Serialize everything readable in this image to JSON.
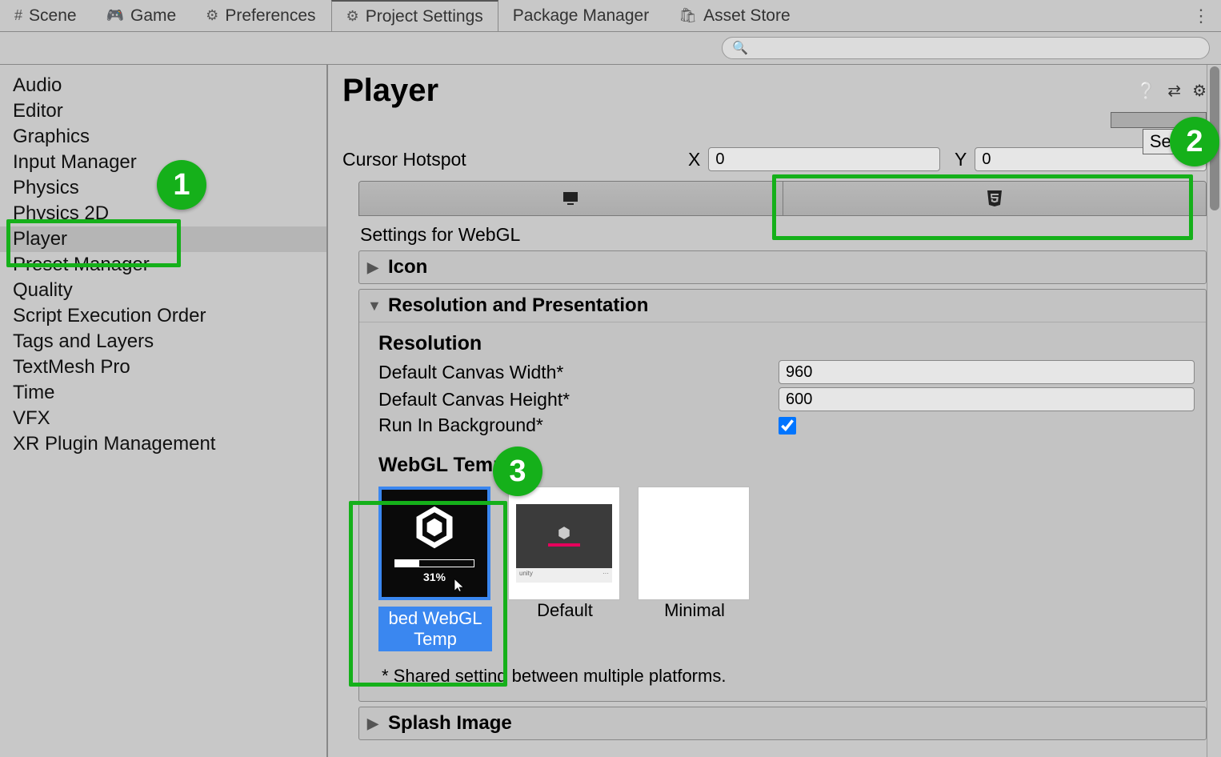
{
  "tabs": {
    "scene": "Scene",
    "game": "Game",
    "preferences": "Preferences",
    "project_settings": "Project Settings",
    "package_manager": "Package Manager",
    "asset_store": "Asset Store"
  },
  "sidebar": {
    "items": [
      "Audio",
      "Editor",
      "Graphics",
      "Input Manager",
      "Physics",
      "Physics 2D",
      "Player",
      "Preset Manager",
      "Quality",
      "Script Execution Order",
      "Tags and Layers",
      "TextMesh Pro",
      "Time",
      "VFX",
      "XR Plugin Management"
    ],
    "selected_index": 6
  },
  "content": {
    "title": "Player",
    "select_button": "Select",
    "cursor_hotspot_label": "Cursor Hotspot",
    "cursor_x": "0",
    "cursor_y": "0",
    "settings_header": "Settings for WebGL",
    "icon_section": "Icon",
    "res_section": "Resolution and Presentation",
    "resolution_heading": "Resolution",
    "canvas_width_label": "Default Canvas Width*",
    "canvas_width": "960",
    "canvas_height_label": "Default Canvas Height*",
    "canvas_height": "600",
    "run_bg_label": "Run In Background*",
    "run_bg_checked": true,
    "template_heading": "WebGL Template",
    "templates": [
      {
        "label": "bed WebGL Temp",
        "selected": true,
        "progress": "31%"
      },
      {
        "label": "Default",
        "selected": false
      },
      {
        "label": "Minimal",
        "selected": false
      }
    ],
    "footnote": "* Shared setting between multiple platforms.",
    "splash_section": "Splash Image"
  },
  "annotations": {
    "n1": "1",
    "n2": "2",
    "n3": "3"
  }
}
